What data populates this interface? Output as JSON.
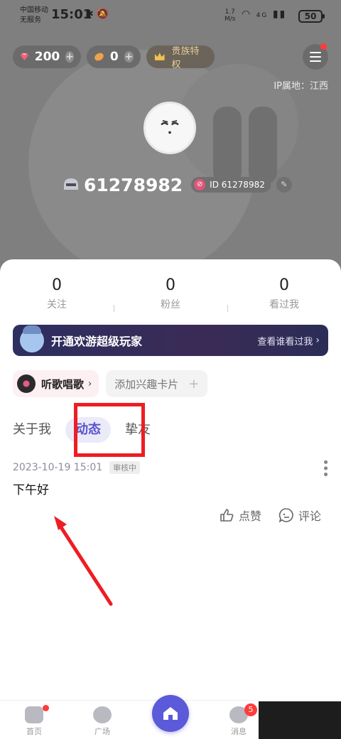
{
  "status_bar": {
    "carrier_line1": "中国移动",
    "carrier_line2": "无服务",
    "time": "15:01",
    "net_speed": "1.7",
    "net_unit": "M/s",
    "signal_type": "4G",
    "battery": "50"
  },
  "header": {
    "gems": "200",
    "coins": "0",
    "vip_label": "贵族特权",
    "ip_location": "IP属地：江西",
    "nickname": "61278982",
    "id_label": "ID 61278982"
  },
  "stats": [
    {
      "value": "0",
      "label": "关注"
    },
    {
      "value": "0",
      "label": "粉丝"
    },
    {
      "value": "0",
      "label": "看过我"
    }
  ],
  "banner": {
    "title": "开通欢游超级玩家",
    "link": "查看谁看过我"
  },
  "tags": {
    "song": "听歌唱歌",
    "add_interest": "添加兴趣卡片"
  },
  "tabs": [
    {
      "label": "关于我",
      "active": false
    },
    {
      "label": "动态",
      "active": true
    },
    {
      "label": "挚友",
      "active": false
    }
  ],
  "post": {
    "date": "2023-10-19   15:01",
    "status": "审核中",
    "text": "下午好",
    "like_label": "点赞",
    "comment_label": "评论"
  },
  "bottom_nav": [
    {
      "label": "首页",
      "icon": "gamepad-icon",
      "has_dot": true
    },
    {
      "label": "广场",
      "icon": "planet-icon",
      "has_dot": false
    },
    {
      "label": "",
      "icon": "home-icon",
      "active": true
    },
    {
      "label": "消息",
      "icon": "message-icon",
      "badge": "5"
    }
  ],
  "colors": {
    "accent": "#5b5ad8",
    "highlight_red": "#ee1d24",
    "header_grey": "#7f7f7f"
  }
}
